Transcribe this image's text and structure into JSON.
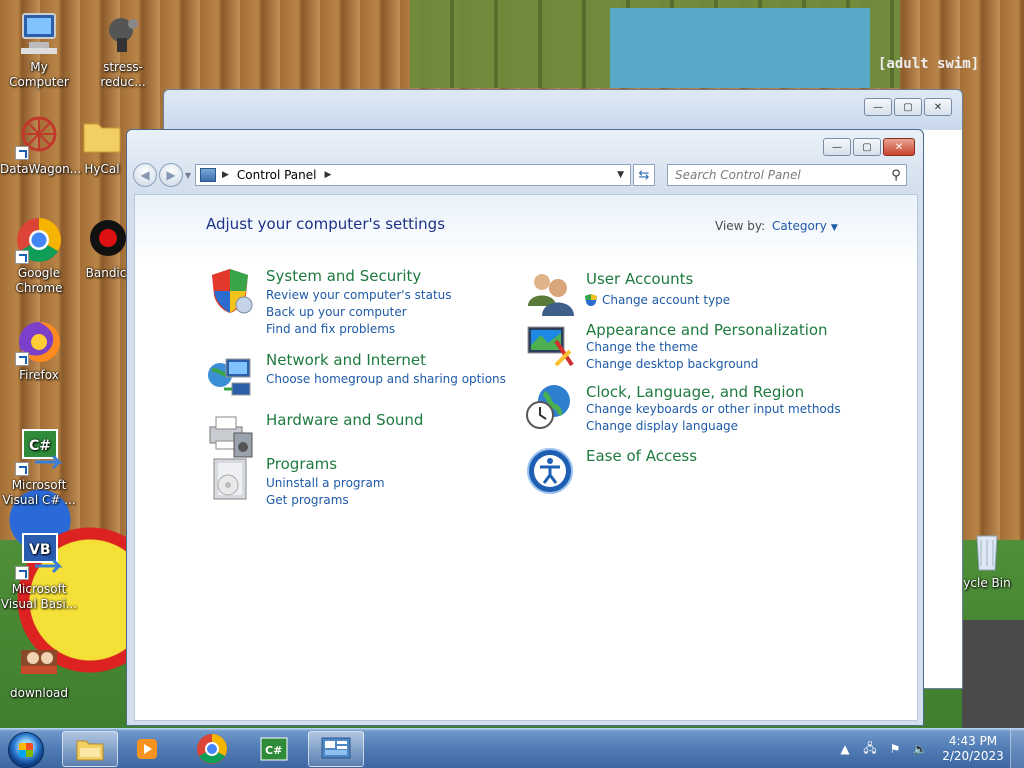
{
  "desktop": {
    "icons": [
      {
        "label": "My Computer",
        "icon": "computer-icon"
      },
      {
        "label": "stress-reduc...",
        "icon": "cartoon-icon"
      },
      {
        "label": "DataWagon...",
        "icon": "datawagon-icon"
      },
      {
        "label": "HyCal",
        "icon": "folder-icon"
      },
      {
        "label": "Google Chrome",
        "icon": "chrome-icon"
      },
      {
        "label": "Bandic",
        "icon": "bandicam-icon"
      },
      {
        "label": "Firefox",
        "icon": "firefox-icon"
      },
      {
        "label": "Microsoft Visual C# ...",
        "icon": "csharp-icon"
      },
      {
        "label": "Microsoft Visual Basi...",
        "icon": "vb-icon"
      },
      {
        "label": "download",
        "icon": "download-icon"
      },
      {
        "label": "ycle Bin",
        "icon": "recycle-bin-icon"
      }
    ],
    "sign_text": "[adult swim]"
  },
  "window": {
    "address": {
      "crumb": "Control Panel"
    },
    "search_placeholder": "Search Control Panel",
    "heading": "Adjust your computer's settings",
    "view_by_label": "View by:",
    "view_by_value": "Category",
    "categories": [
      {
        "title": "System and Security",
        "icon": "shield-icon",
        "links": [
          "Review your computer's status",
          "Back up your computer",
          "Find and fix problems"
        ]
      },
      {
        "title": "Network and Internet",
        "icon": "network-icon",
        "links": [
          "Choose homegroup and sharing options"
        ]
      },
      {
        "title": "Hardware and Sound",
        "icon": "printer-icon",
        "links": []
      },
      {
        "title": "Programs",
        "icon": "programs-icon",
        "links": [
          "Uninstall a program",
          "Get programs"
        ]
      },
      {
        "title": "User Accounts",
        "icon": "users-icon",
        "links": [
          "Change account type"
        ]
      },
      {
        "title": "Appearance and Personalization",
        "icon": "appearance-icon",
        "links": [
          "Change the theme",
          "Change desktop background"
        ]
      },
      {
        "title": "Clock, Language, and Region",
        "icon": "clock-globe-icon",
        "links": [
          "Change keyboards or other input methods",
          "Change display language"
        ]
      },
      {
        "title": "Ease of Access",
        "icon": "ease-of-access-icon",
        "links": []
      }
    ]
  },
  "taskbar": {
    "apps": [
      "explorer",
      "media-player",
      "chrome",
      "visual-csharp",
      "control-panel"
    ],
    "time": "4:43 PM",
    "date": "2/20/2023"
  }
}
